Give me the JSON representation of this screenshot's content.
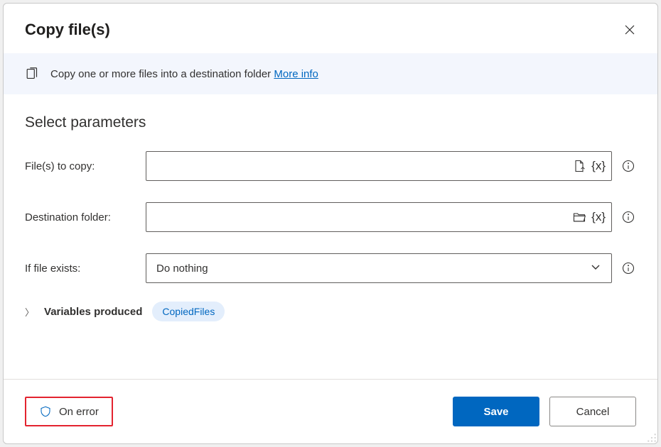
{
  "dialog": {
    "title": "Copy file(s)",
    "infoText": "Copy one or more files into a destination folder",
    "moreInfoLabel": "More info",
    "sectionTitle": "Select parameters"
  },
  "fields": {
    "filesToCopy": {
      "label": "File(s) to copy:",
      "value": ""
    },
    "destinationFolder": {
      "label": "Destination folder:",
      "value": ""
    },
    "ifFileExists": {
      "label": "If file exists:",
      "selected": "Do nothing"
    }
  },
  "variables": {
    "heading": "Variables produced",
    "chip": "CopiedFiles"
  },
  "footer": {
    "onErrorLabel": "On error",
    "saveLabel": "Save",
    "cancelLabel": "Cancel"
  }
}
